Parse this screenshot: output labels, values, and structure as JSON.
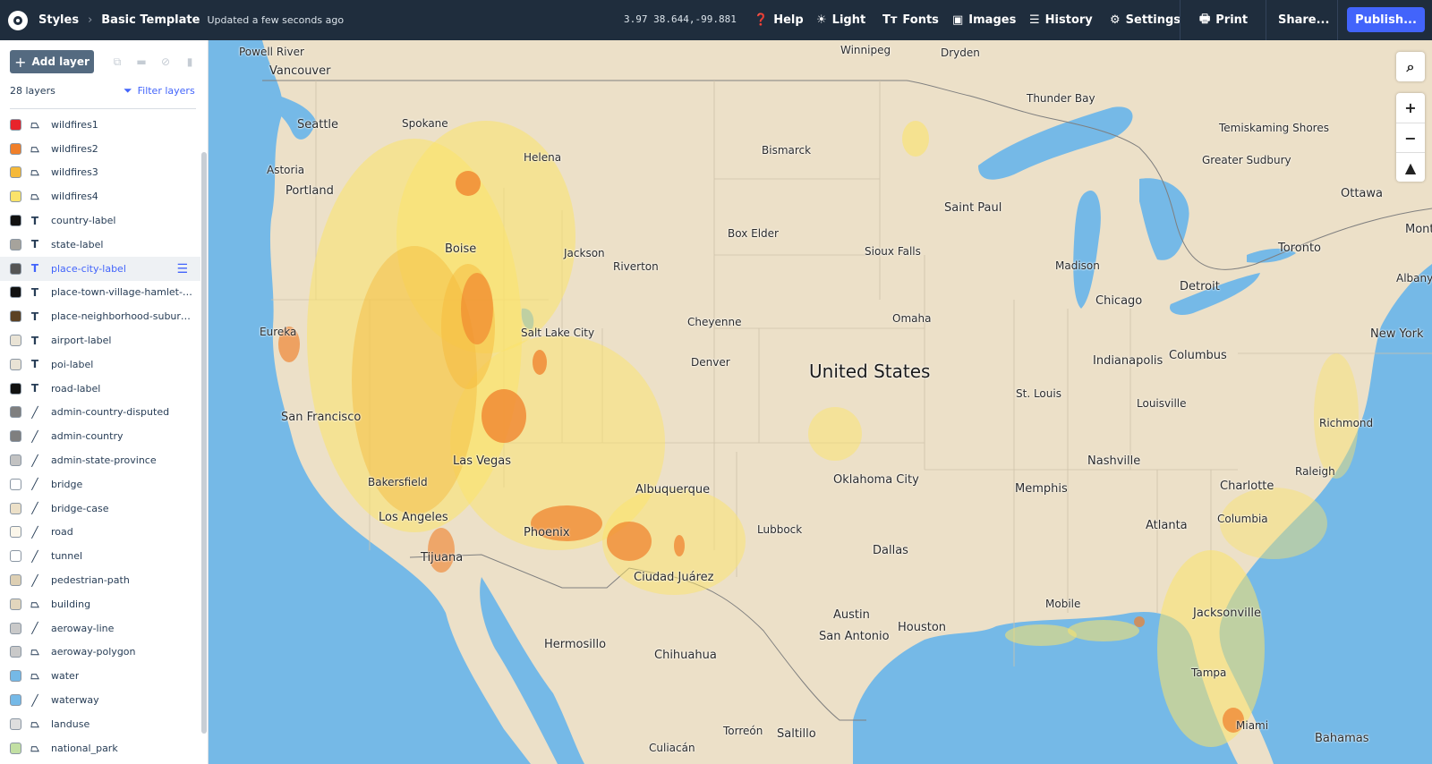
{
  "topbar": {
    "styles_label": "Styles",
    "template_name": "Basic Template",
    "updated_text": "Updated a few seconds ago",
    "coordinates": "3.97 38.644,-99.881",
    "help": "Help",
    "light": "Light",
    "fonts": "Fonts",
    "images": "Images",
    "history": "History",
    "settings": "Settings",
    "print": "Print",
    "share": "Share...",
    "publish": "Publish..."
  },
  "sidebar": {
    "add_layer": "Add layer",
    "layer_count": "28 layers",
    "filter_layers": "Filter layers",
    "layers": [
      {
        "name": "wildfires1",
        "type": "fill",
        "color": "#e8242b"
      },
      {
        "name": "wildfires2",
        "type": "fill",
        "color": "#f07f2a"
      },
      {
        "name": "wildfires3",
        "type": "fill",
        "color": "#f5b93a"
      },
      {
        "name": "wildfires4",
        "type": "fill",
        "color": "#fbe36a"
      },
      {
        "name": "country-label",
        "type": "symbol",
        "color": "#111111"
      },
      {
        "name": "state-label",
        "type": "symbol",
        "color": "#a6a39c"
      },
      {
        "name": "place-city-label",
        "type": "symbol",
        "color": "#555555"
      },
      {
        "name": "place-town-village-hamlet-la...",
        "type": "symbol",
        "color": "#111111"
      },
      {
        "name": "place-neighborhood-suburb-...",
        "type": "symbol",
        "color": "#5b4123"
      },
      {
        "name": "airport-label",
        "type": "symbol-icon",
        "color": "#e9e3d5"
      },
      {
        "name": "poi-label",
        "type": "symbol-icon",
        "color": "#e9e3d5"
      },
      {
        "name": "road-label",
        "type": "symbol",
        "color": "#111111"
      },
      {
        "name": "admin-country-disputed",
        "type": "line",
        "color": "#7f7f7f"
      },
      {
        "name": "admin-country",
        "type": "line",
        "color": "#7f7f7f"
      },
      {
        "name": "admin-state-province",
        "type": "line",
        "color": "#c2c2c2"
      },
      {
        "name": "bridge",
        "type": "line",
        "color": "#ffffff"
      },
      {
        "name": "bridge-case",
        "type": "line",
        "color": "#ece0c8"
      },
      {
        "name": "road",
        "type": "line",
        "color": "#fbf6ea"
      },
      {
        "name": "tunnel",
        "type": "line",
        "color": "#ffffff"
      },
      {
        "name": "pedestrian-path",
        "type": "line",
        "color": "#ddcfb3"
      },
      {
        "name": "building",
        "type": "fill",
        "color": "#e2d6bd"
      },
      {
        "name": "aeroway-line",
        "type": "line",
        "color": "#c9c9c9"
      },
      {
        "name": "aeroway-polygon",
        "type": "fill",
        "color": "#c9c9c9"
      },
      {
        "name": "water",
        "type": "fill",
        "color": "#75b9e7"
      },
      {
        "name": "waterway",
        "type": "line",
        "color": "#75b9e7"
      },
      {
        "name": "landuse",
        "type": "fill",
        "color": "#dedede"
      },
      {
        "name": "national_park",
        "type": "fill",
        "color": "#c2dfa3"
      }
    ]
  },
  "map": {
    "country_label": "United States",
    "cities": [
      "Powell River",
      "Vancouver",
      "Seattle",
      "Spokane",
      "Astoria",
      "Portland",
      "Helena",
      "Bismarck",
      "Winnipeg",
      "Dryden",
      "Thunder Bay",
      "Temiskaming Shores",
      "Greater Sudbury",
      "Ottawa",
      "Montp",
      "Saint Paul",
      "Boise",
      "Jackson",
      "Riverton",
      "Box Elder",
      "Sioux Falls",
      "Madison",
      "Toronto",
      "Albany",
      "Detroit",
      "Chicago",
      "Eureka",
      "Salt Lake City",
      "Cheyenne",
      "Omaha",
      "New York",
      "Denver",
      "Indianapolis",
      "Columbus",
      "San Francisco",
      "St. Louis",
      "Louisville",
      "Richmond",
      "Las Vegas",
      "Nashville",
      "Bakersfield",
      "Albuquerque",
      "Oklahoma City",
      "Memphis",
      "Charlotte",
      "Raleigh",
      "Los Angeles",
      "Atlanta",
      "Columbia",
      "Phoenix",
      "Lubbock",
      "Tijuana",
      "Dallas",
      "Ciudad Juárez",
      "Mobile",
      "Austin",
      "Jacksonville",
      "Houston",
      "San Antonio",
      "Hermosillo",
      "Chihuahua",
      "Tampa",
      "Miami",
      "Torreón",
      "Saltillo",
      "Bahamas",
      "Culiacán"
    ],
    "colors": {
      "land": "#ece0c8",
      "water": "#75b9e7",
      "fire1": "#e8242b",
      "fire2": "#f07f2a",
      "fire3": "#f5b93a",
      "fire4": "#fbe36a"
    }
  }
}
